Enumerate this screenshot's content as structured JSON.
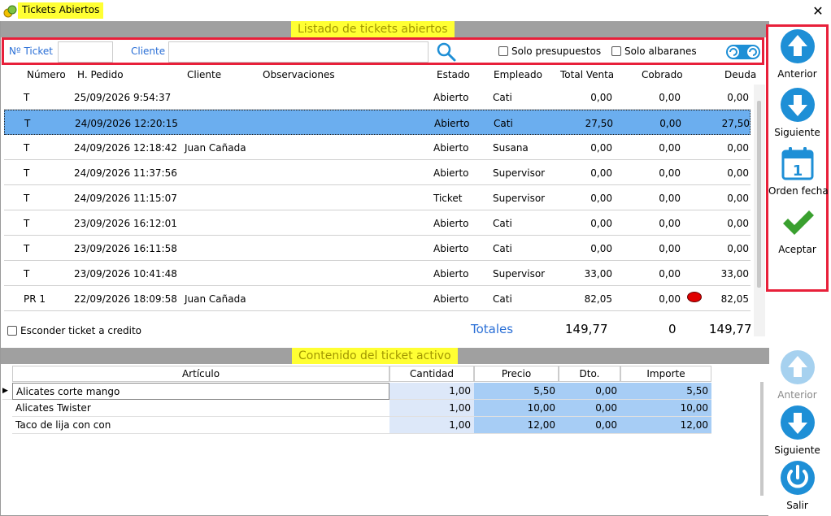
{
  "window": {
    "title": "Tickets Abiertos"
  },
  "sections": {
    "list_title": "Listado de tickets abiertos",
    "content_title": "Contenido del ticket activo"
  },
  "filters": {
    "ticket_label": "Nº Ticket",
    "ticket_value": "",
    "client_label": "Cliente",
    "client_value": "",
    "only_budgets": "Solo presupuestos",
    "only_delivery": "Solo albaranes"
  },
  "tickets": {
    "columns": [
      "Número",
      "H. Pedido",
      "Cliente",
      "Observaciones",
      "Estado",
      "Empleado",
      "Total Venta",
      "Cobrado",
      "Deuda"
    ],
    "rows": [
      {
        "num": "T",
        "date": "25/09/2026 9:54:37",
        "client": "",
        "obs": "",
        "state": "Abierto",
        "emp": "Cati",
        "total": "0,00",
        "paid": "0,00",
        "debt": "0,00"
      },
      {
        "num": "T",
        "date": "24/09/2026 12:20:15",
        "client": "",
        "obs": "",
        "state": "Abierto",
        "emp": "Cati",
        "total": "27,50",
        "paid": "0,00",
        "debt": "27,50"
      },
      {
        "num": "T",
        "date": "24/09/2026 12:18:42",
        "client": "Juan Cañada",
        "obs": "",
        "state": "Abierto",
        "emp": "Susana",
        "total": "0,00",
        "paid": "0,00",
        "debt": "0,00"
      },
      {
        "num": "T",
        "date": "24/09/2026 11:37:56",
        "client": "",
        "obs": "",
        "state": "Abierto",
        "emp": "Supervisor",
        "total": "0,00",
        "paid": "0,00",
        "debt": "0,00"
      },
      {
        "num": "T",
        "date": "24/09/2026 11:15:07",
        "client": "",
        "obs": "",
        "state": "Ticket",
        "emp": "Supervisor",
        "total": "0,00",
        "paid": "0,00",
        "debt": "0,00"
      },
      {
        "num": "T",
        "date": "23/09/2026 16:12:01",
        "client": "",
        "obs": "",
        "state": "Abierto",
        "emp": "Cati",
        "total": "0,00",
        "paid": "0,00",
        "debt": "0,00"
      },
      {
        "num": "T",
        "date": "23/09/2026 16:11:58",
        "client": "",
        "obs": "",
        "state": "Abierto",
        "emp": "Cati",
        "total": "0,00",
        "paid": "0,00",
        "debt": "0,00"
      },
      {
        "num": "T",
        "date": "23/09/2026 10:41:48",
        "client": "",
        "obs": "",
        "state": "Abierto",
        "emp": "Supervisor",
        "total": "33,00",
        "paid": "0,00",
        "debt": "33,00"
      },
      {
        "num": "PR 1",
        "date": "22/09/2026 18:09:58",
        "client": "Juan Cañada",
        "obs": "",
        "state": "Abierto",
        "emp": "Cati",
        "total": "82,05",
        "paid": "0,00",
        "debt": "82,05"
      }
    ],
    "selected_index": 1
  },
  "footer": {
    "hide_credit": "Esconder ticket a credito",
    "totals_label": "Totales",
    "total_sales": "149,77",
    "total_paid": "0",
    "total_debt": "149,77"
  },
  "items": {
    "columns": [
      "Artículo",
      "Cantidad",
      "Precio",
      "Dto.",
      "Importe"
    ],
    "rows": [
      {
        "art": "Alicates corte mango",
        "qty": "1,00",
        "price": "5,50",
        "dto": "0,00",
        "imp": "5,50"
      },
      {
        "art": "Alicates Twister",
        "qty": "1,00",
        "price": "10,00",
        "dto": "0,00",
        "imp": "10,00"
      },
      {
        "art": "Taco de lija con con",
        "qty": "1,00",
        "price": "12,00",
        "dto": "0,00",
        "imp": "12,00"
      }
    ]
  },
  "side_top": {
    "prev": "Anterior",
    "next": "Siguiente",
    "order_date": "Orden fecha",
    "accept": "Aceptar"
  },
  "side_bottom": {
    "prev": "Anterior",
    "next": "Siguiente",
    "exit": "Salir"
  },
  "colors": {
    "accent_blue": "#1e8fd6",
    "highlight_red": "#e8203a",
    "selection": "#6baeef",
    "label_yellow": "#ffff33",
    "status_dot": "#e00000"
  }
}
